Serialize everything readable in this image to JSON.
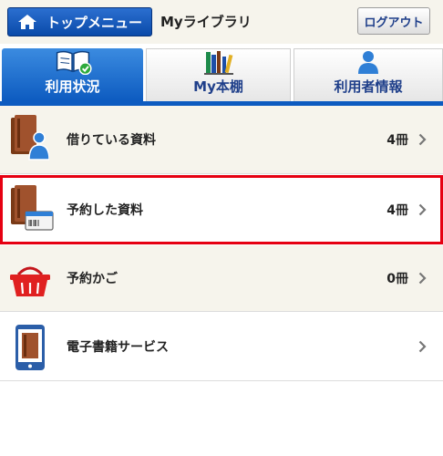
{
  "header": {
    "top_menu_label": "トップメニュー",
    "title": "Myライブラリ",
    "logout_label": "ログアウト"
  },
  "tabs": [
    {
      "label": "利用状況",
      "icon": "open-book-check-icon",
      "active": true
    },
    {
      "label": "My本棚",
      "icon": "bookshelf-icon",
      "active": false
    },
    {
      "label": "利用者情報",
      "icon": "person-icon",
      "active": false
    }
  ],
  "items": [
    {
      "label": "借りている資料",
      "count": "4冊",
      "icon": "books-person-icon"
    },
    {
      "label": "予約した資料",
      "count": "4冊",
      "icon": "books-card-icon",
      "highlighted": true
    },
    {
      "label": "予約かご",
      "count": "0冊",
      "icon": "basket-icon"
    },
    {
      "label": "電子書籍サービス",
      "count": "",
      "icon": "ebook-tablet-icon"
    }
  ],
  "colors": {
    "primary_blue": "#0d5bc0",
    "highlight_red": "#e60012",
    "row_beige": "#f6f4ec"
  }
}
